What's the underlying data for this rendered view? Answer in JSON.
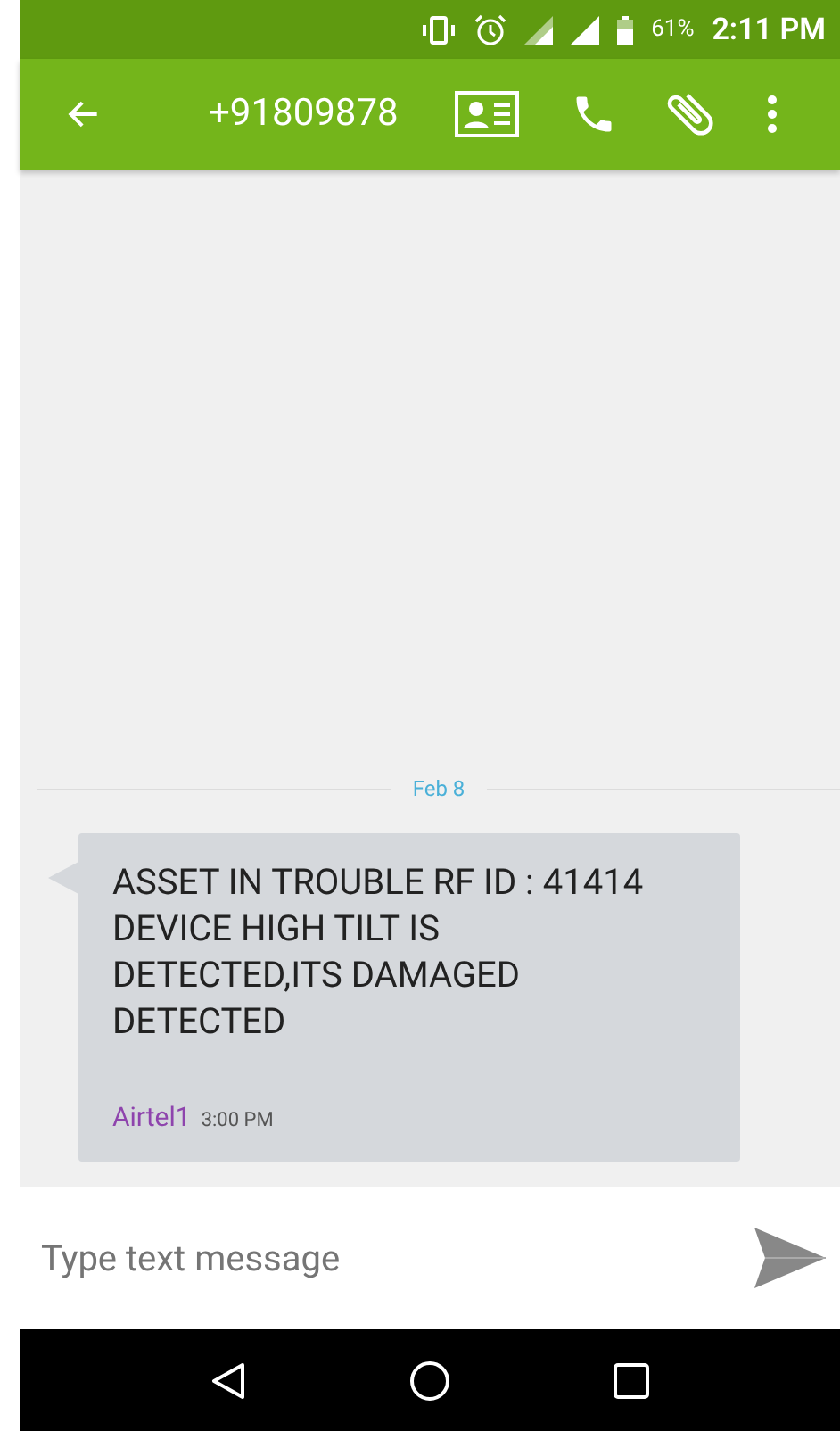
{
  "status_bar": {
    "battery": "61%",
    "time": "2:11 PM"
  },
  "toolbar": {
    "title": "+91809878"
  },
  "conversation": {
    "date": "Feb 8",
    "messages": [
      {
        "text": "ASSET IN TROUBLE RF ID : 41414 DEVICE HIGH TILT IS DETECTED,ITS DAMAGED DETECTED",
        "sender": "Airtel1",
        "time": "3:00 PM"
      }
    ]
  },
  "composer": {
    "placeholder": "Type text message"
  }
}
